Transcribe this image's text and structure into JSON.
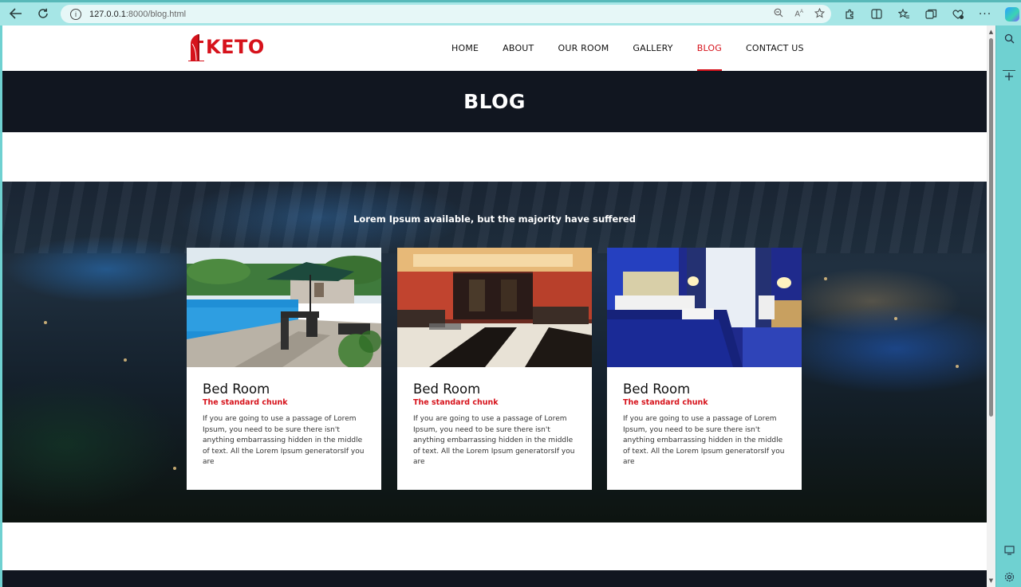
{
  "browser": {
    "url_host": "127.0.0.1",
    "url_path": ":8000/blog.html"
  },
  "site": {
    "logo_text": "KETO",
    "nav": [
      {
        "label": "HOME",
        "active": false
      },
      {
        "label": "ABOUT",
        "active": false
      },
      {
        "label": "OUR ROOM",
        "active": false
      },
      {
        "label": "GALLERY",
        "active": false
      },
      {
        "label": "BLOG",
        "active": true
      },
      {
        "label": "CONTACT US",
        "active": false
      }
    ],
    "banner_title": "BLOG",
    "section_subtitle": "Lorem Ipsum available, but the majority have suffered",
    "cards": [
      {
        "title": "Bed Room",
        "subtitle": "The standard chunk",
        "text": "If you are going to use a passage of Lorem Ipsum, you need to be sure there isn't anything embarrassing hidden in the middle of text. All the Lorem Ipsum generatorsIf you are",
        "image": "pool-terrace-photo"
      },
      {
        "title": "Bed Room",
        "subtitle": "The standard chunk",
        "text": "If you are going to use a passage of Lorem Ipsum, you need to be sure there isn't anything embarrassing hidden in the middle of text. All the Lorem Ipsum generatorsIf you are",
        "image": "hotel-lobby-photo"
      },
      {
        "title": "Bed Room",
        "subtitle": "The standard chunk",
        "text": "If you are going to use a passage of Lorem Ipsum, you need to be sure there isn't anything embarrassing hidden in the middle of text. All the Lorem Ipsum generatorsIf you are",
        "image": "bedroom-photo"
      }
    ]
  },
  "colors": {
    "accent": "#d6121b",
    "dark": "#111620",
    "browser_frame": "#a6e6e6"
  }
}
